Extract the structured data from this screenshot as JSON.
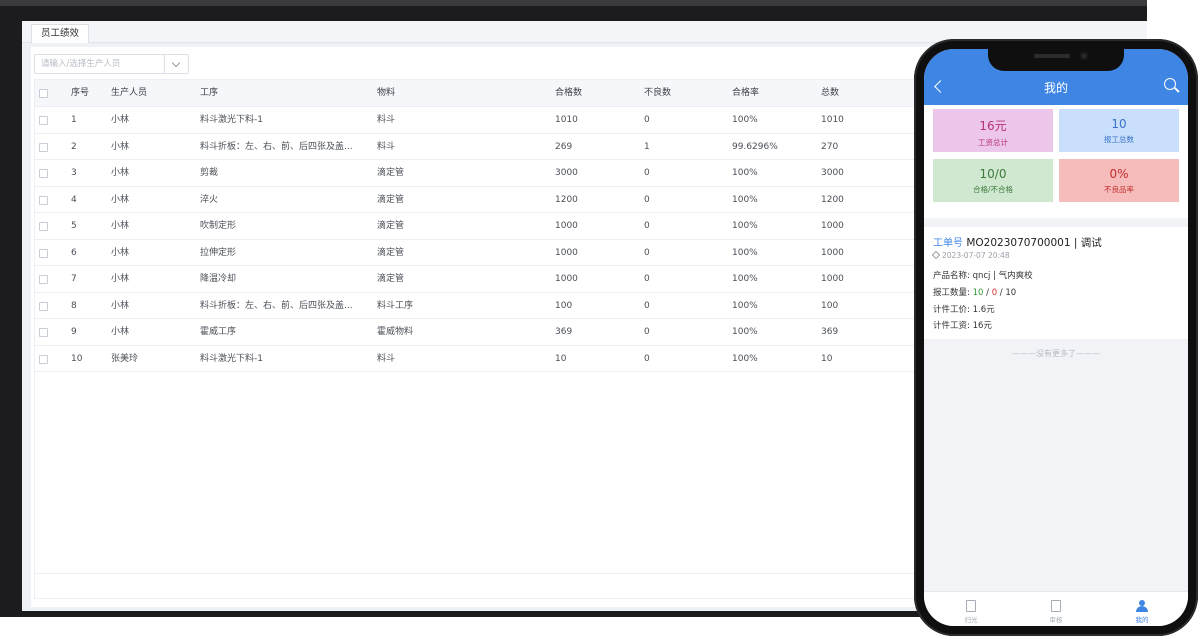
{
  "desktop": {
    "tab_label": "员工绩效",
    "filter": {
      "placeholder": "请输入/选择生产人员"
    },
    "columns": [
      "序号",
      "生产人员",
      "工序",
      "物料",
      "合格数",
      "不良数",
      "合格率",
      "总数"
    ],
    "rows": [
      [
        "1",
        "小林",
        "料斗激光下料-1",
        "料斗",
        "1010",
        "0",
        "100%",
        "1010"
      ],
      [
        "2",
        "小林",
        "料斗折板：左、右、前、后四张及盖...",
        "料斗",
        "269",
        "1",
        "99.6296%",
        "270"
      ],
      [
        "3",
        "小林",
        "剪裁",
        "滴定管",
        "3000",
        "0",
        "100%",
        "3000"
      ],
      [
        "4",
        "小林",
        "淬火",
        "滴定管",
        "1200",
        "0",
        "100%",
        "1200"
      ],
      [
        "5",
        "小林",
        "吹制定形",
        "滴定管",
        "1000",
        "0",
        "100%",
        "1000"
      ],
      [
        "6",
        "小林",
        "拉伸定形",
        "滴定管",
        "1000",
        "0",
        "100%",
        "1000"
      ],
      [
        "7",
        "小林",
        "降温冷却",
        "滴定管",
        "1000",
        "0",
        "100%",
        "1000"
      ],
      [
        "8",
        "小林",
        "料斗折板：左、右、前、后四张及盖...",
        "料斗工序",
        "100",
        "0",
        "100%",
        "100"
      ],
      [
        "9",
        "小林",
        "霍威工序",
        "霍威物料",
        "369",
        "0",
        "100%",
        "369"
      ],
      [
        "10",
        "张美玲",
        "料斗激光下料-1",
        "料斗",
        "10",
        "0",
        "100%",
        "10"
      ]
    ]
  },
  "phone": {
    "title": "我的",
    "stats": [
      {
        "value": "16元",
        "label": "工资总计"
      },
      {
        "value": "10",
        "label": "报工总数"
      },
      {
        "value": "10/0",
        "label": "合格/不合格"
      },
      {
        "value": "0%",
        "label": "不良品率"
      }
    ],
    "work_order": {
      "key": "工单号",
      "value": "MO2023070700001 | 调试",
      "date": "2023-07-07 20:48",
      "product_label": "产品名称:",
      "product_value": "qncj | 气内爽校",
      "report_label": "报工数量:",
      "report_ok": "10",
      "report_sep1": " / ",
      "report_bad": "0",
      "report_sep2": " / ",
      "report_total": "10",
      "price_label": "计件工价:",
      "price_value": "1.6元",
      "wage_label": "计件工资:",
      "wage_value": "16元"
    },
    "no_more": "———没有更多了———",
    "tabs": [
      "扫光",
      "审核",
      "我的"
    ]
  }
}
